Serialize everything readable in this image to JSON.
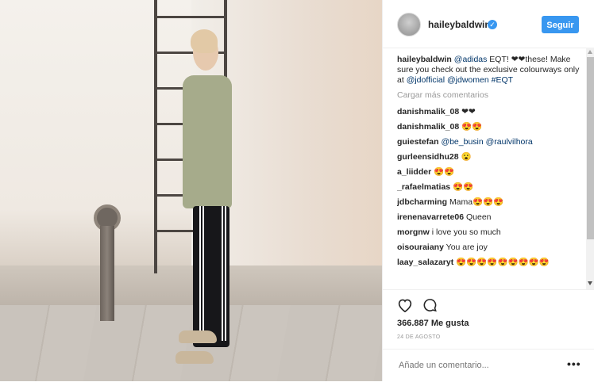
{
  "header": {
    "username": "haileybaldwin",
    "follow_label": "Seguir"
  },
  "caption": {
    "username": "haileybaldwin",
    "tag_adidas": "@adidas",
    "text1": " EQT! ❤❤these! Make sure you check out the exclusive colourways only at ",
    "tag_jd": "@jdofficial",
    "tag_jdw": "@jdwomen",
    "hashtag": "#EQT"
  },
  "load_more": "Cargar más comentarios",
  "comments": [
    {
      "user": "danishmalik_08",
      "text": "❤❤"
    },
    {
      "user": "danishmalik_08",
      "text": "😍😍"
    },
    {
      "user": "guiestefan",
      "text": "@be_busin @raulvilhora"
    },
    {
      "user": "gurleensidhu28",
      "text": "😮"
    },
    {
      "user": "a_liidder",
      "text": "😍😍"
    },
    {
      "user": "_rafaelmatias",
      "text": "😍😍"
    },
    {
      "user": "jdbcharming",
      "text": "Mama😍😍😍"
    },
    {
      "user": "irenenavarrete06",
      "text": "Queen"
    },
    {
      "user": "morgnw",
      "text": "i love you so much"
    },
    {
      "user": "oisouraiany",
      "text": "You are joy"
    },
    {
      "user": "laay_salazaryt",
      "text": "😍😍😍😍😍😍😍😍😍"
    }
  ],
  "likes": "366.887 Me gusta",
  "date": "24 DE AGOSTO",
  "add_comment_placeholder": "Añade un comentario...",
  "more_options": "•••",
  "icons": {
    "verified": "verified-badge-icon",
    "like": "heart-icon",
    "comment": "comment-bubble-icon"
  },
  "colors": {
    "accent": "#3897f0",
    "tag": "#003569",
    "muted": "#999999"
  }
}
